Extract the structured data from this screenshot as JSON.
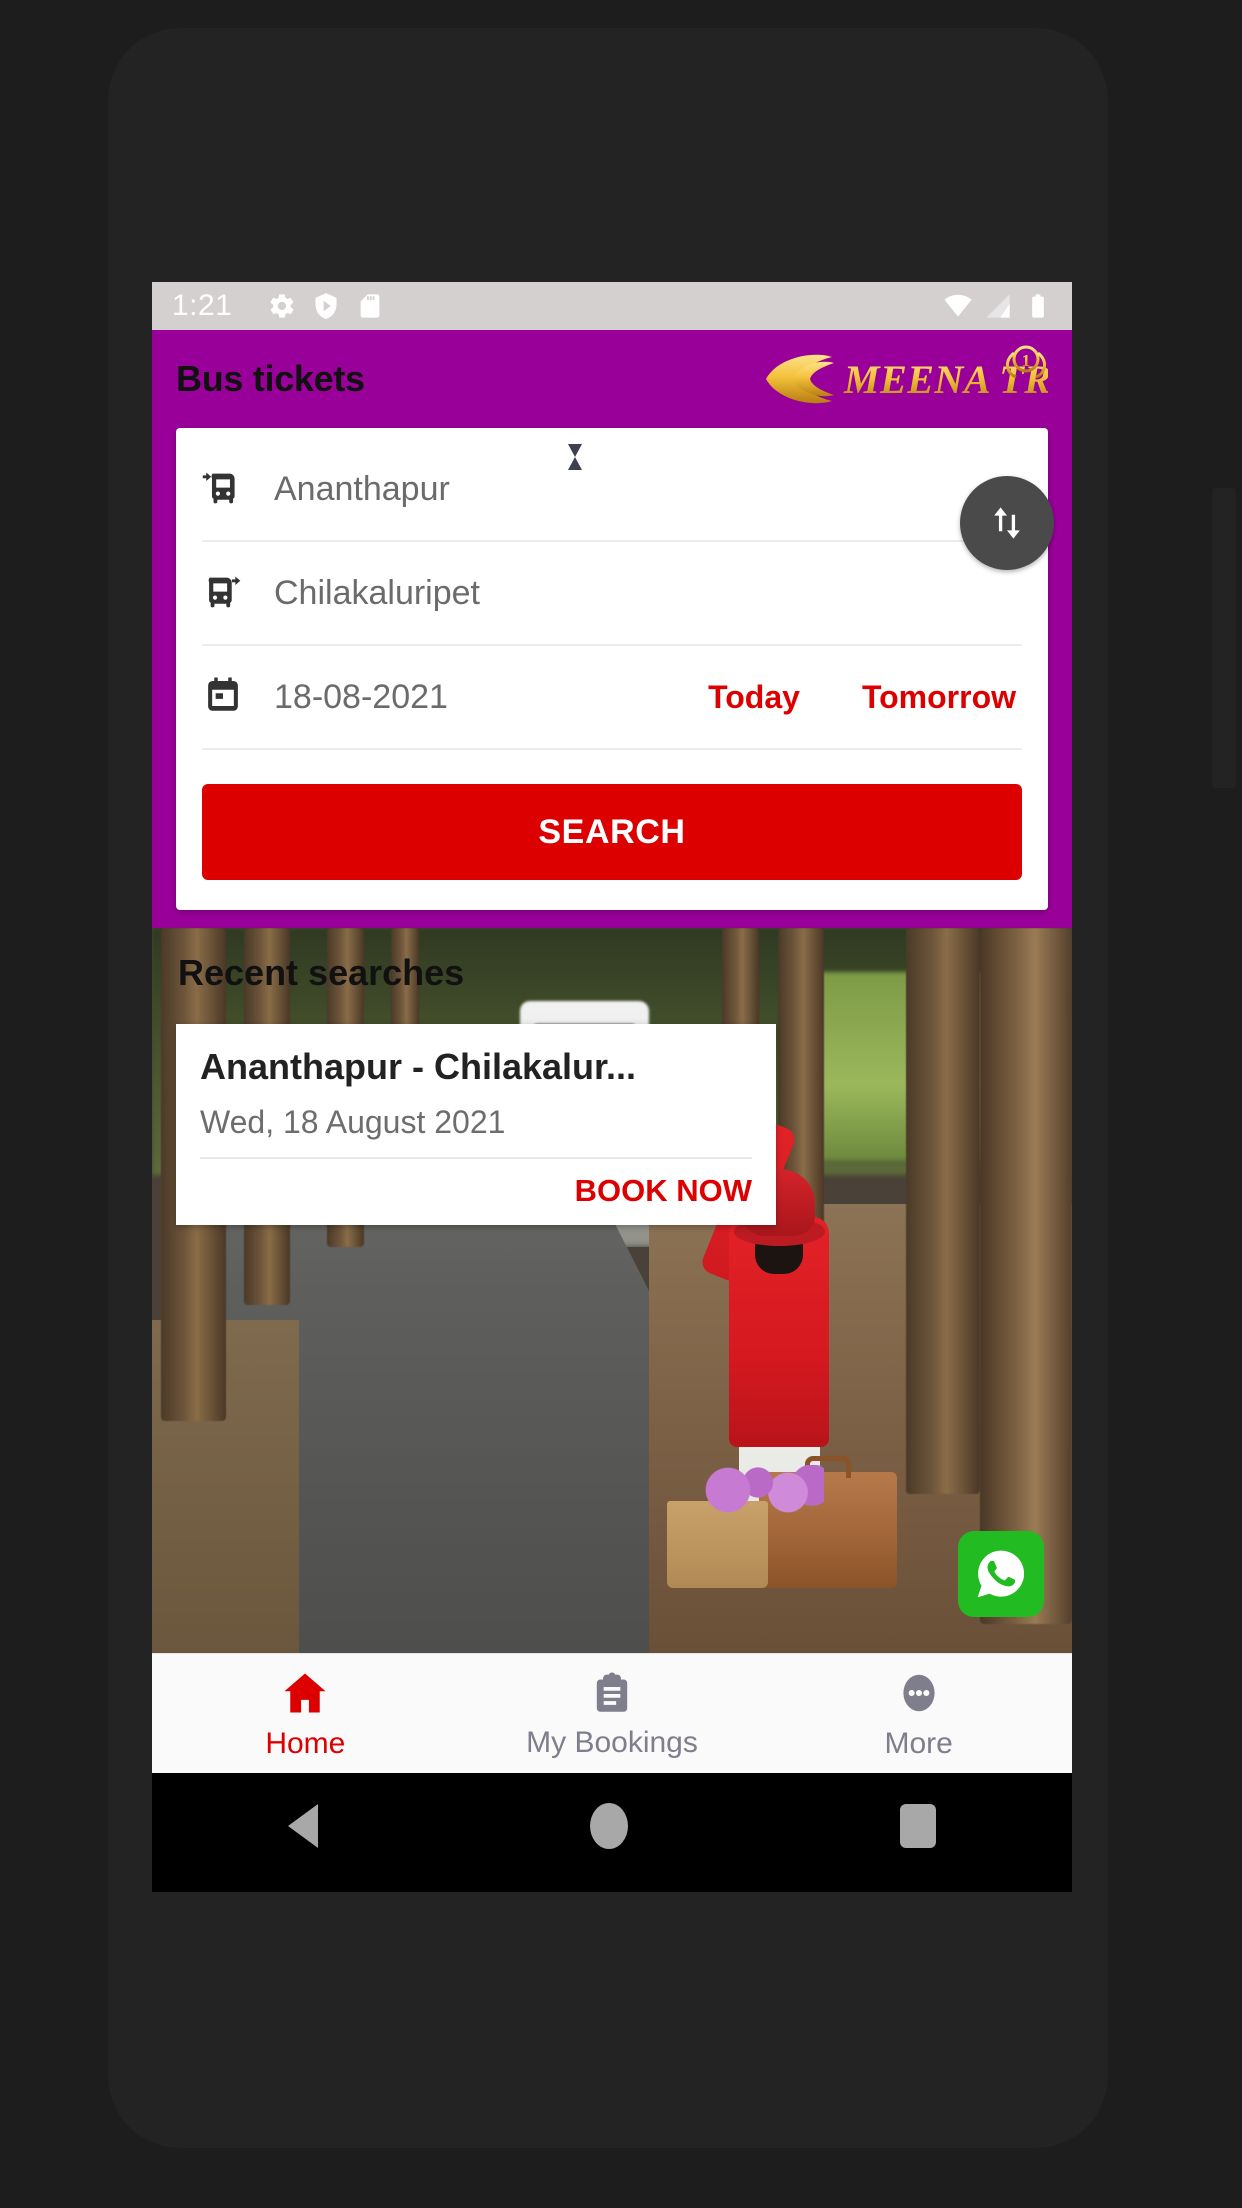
{
  "status_bar": {
    "time": "1:21",
    "left_icons": [
      "gear-icon",
      "play-protect-shield-icon",
      "sd-card-icon"
    ],
    "right_icons": [
      "wifi-icon",
      "cellular-signal-icon",
      "battery-icon"
    ]
  },
  "app_bar": {
    "title": "Bus tickets",
    "logo_text": "MEENA TRAVELS",
    "logo_badge": "1",
    "background_color": "#990099"
  },
  "search_form": {
    "source": {
      "value": "Ananthapur",
      "icon": "bus-arrive-icon"
    },
    "destination": {
      "value": "Chilakaluripet",
      "icon": "bus-depart-icon"
    },
    "swap_button": "swap-vertical-icon",
    "date": {
      "value": "18-08-2021",
      "icon": "calendar-icon"
    },
    "quick_dates": [
      "Today",
      "Tomorrow"
    ],
    "search_label": "SEARCH",
    "accent_color": "#dd0000"
  },
  "recent": {
    "heading": "Recent searches",
    "items": [
      {
        "route": "Ananthapur - Chilakalur...",
        "date": "Wed, 18 August 2021",
        "action": "BOOK NOW"
      }
    ]
  },
  "floating_action": {
    "name": "whatsapp-button",
    "color": "#22bb22"
  },
  "bottom_nav": {
    "items": [
      {
        "label": "Home",
        "icon": "home-icon",
        "active": true
      },
      {
        "label": "My Bookings",
        "icon": "clipboard-icon",
        "active": false
      },
      {
        "label": "More",
        "icon": "more-dots-icon",
        "active": false
      }
    ],
    "active_color": "#dd0000",
    "inactive_color": "#7e7e8c"
  },
  "android_nav": {
    "buttons": [
      "back-button",
      "home-button",
      "recents-button"
    ]
  }
}
